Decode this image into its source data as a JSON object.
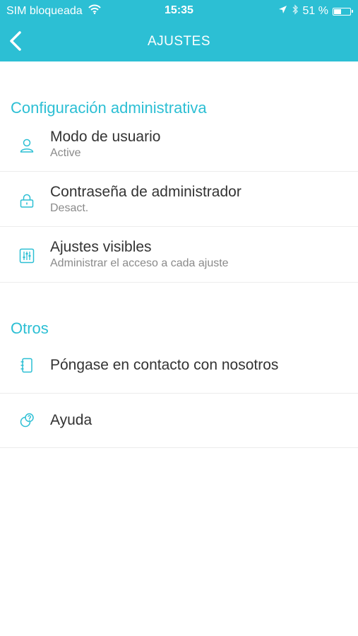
{
  "status_bar": {
    "carrier": "SIM bloqueada",
    "time": "15:35",
    "battery": "51 %",
    "battery_level": 0.51,
    "icons": [
      "wifi-icon",
      "location-arrow-icon",
      "bluetooth-icon",
      "battery-icon"
    ]
  },
  "nav": {
    "title": "AJUSTES",
    "back_icon": "chevron-left-icon"
  },
  "sections": {
    "admin": {
      "header": "Configuración administrativa",
      "items": [
        {
          "label": "Modo de usuario",
          "value": "Active",
          "icon": "user-icon"
        },
        {
          "label": "Contraseña de administrador",
          "value": "Desact.",
          "icon": "lock-icon"
        },
        {
          "label": "Ajustes visibles",
          "value": "Administrar el acceso a cada ajuste",
          "icon": "sliders-icon"
        }
      ]
    },
    "others": {
      "header": "Otros",
      "items": [
        {
          "label": "Póngase en contacto con nosotros",
          "icon": "contact-book-icon"
        },
        {
          "label": "Ayuda",
          "icon": "help-icon"
        }
      ]
    }
  },
  "colors": {
    "accent": "#2cbfd4",
    "primary_text": "#333333",
    "secondary_text": "#8a8a8a",
    "divider": "#ececec"
  }
}
